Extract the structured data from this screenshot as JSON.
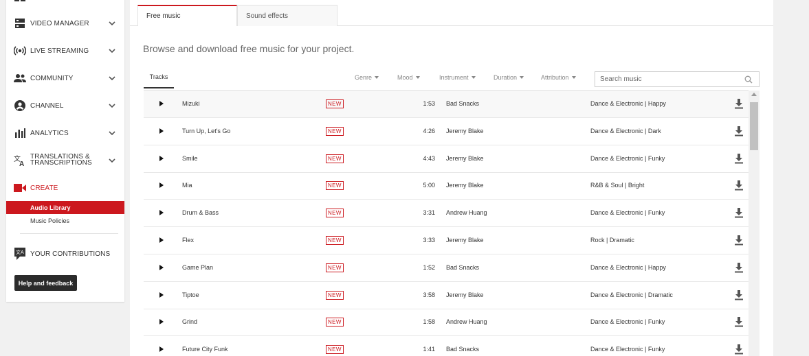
{
  "sidebar": {
    "items": [
      {
        "label": "VIDEO MANAGER",
        "icon": "video-manager-icon"
      },
      {
        "label": "LIVE STREAMING",
        "icon": "live-streaming-icon"
      },
      {
        "label": "COMMUNITY",
        "icon": "community-icon"
      },
      {
        "label": "CHANNEL",
        "icon": "channel-icon"
      },
      {
        "label": "ANALYTICS",
        "icon": "analytics-icon"
      },
      {
        "label": "TRANSLATIONS &",
        "label2": "TRANSCRIPTIONS",
        "icon": "translate-icon"
      },
      {
        "label": "CREATE",
        "icon": "create-icon"
      }
    ],
    "create_sub": [
      "Audio Library",
      "Music Policies"
    ],
    "contributions_label": "YOUR CONTRIBUTIONS",
    "help_label": "Help and feedback"
  },
  "tabs": [
    "Free music",
    "Sound effects"
  ],
  "headline": "Browse and download free music for your project.",
  "tracks_tab": "Tracks",
  "filters": [
    "Genre",
    "Mood",
    "Instrument",
    "Duration",
    "Attribution"
  ],
  "search": {
    "placeholder": "Search music"
  },
  "new_badge": "NEW",
  "tracks": [
    {
      "title": "Mizuki",
      "duration": "1:53",
      "artist": "Bad Snacks",
      "genre": "Dance & Electronic | Happy"
    },
    {
      "title": "Turn Up, Let's Go",
      "duration": "4:26",
      "artist": "Jeremy Blake",
      "genre": "Dance & Electronic | Dark"
    },
    {
      "title": "Smile",
      "duration": "4:43",
      "artist": "Jeremy Blake",
      "genre": "Dance & Electronic | Funky"
    },
    {
      "title": "Mia",
      "duration": "5:00",
      "artist": "Jeremy Blake",
      "genre": "R&B & Soul | Bright"
    },
    {
      "title": "Drum & Bass",
      "duration": "3:31",
      "artist": "Andrew Huang",
      "genre": "Dance & Electronic | Funky"
    },
    {
      "title": "Flex",
      "duration": "3:33",
      "artist": "Jeremy Blake",
      "genre": "Rock | Dramatic"
    },
    {
      "title": "Game Plan",
      "duration": "1:52",
      "artist": "Bad Snacks",
      "genre": "Dance & Electronic | Happy"
    },
    {
      "title": "Tiptoe",
      "duration": "3:58",
      "artist": "Jeremy Blake",
      "genre": "Dance & Electronic | Dramatic"
    },
    {
      "title": "Grind",
      "duration": "1:58",
      "artist": "Andrew Huang",
      "genre": "Dance & Electronic | Funky"
    },
    {
      "title": "Future City Funk",
      "duration": "1:41",
      "artist": "Bad Snacks",
      "genre": "Dance & Electronic | Funky"
    }
  ],
  "colors": {
    "accent": "#cc181e",
    "dark": "#2b2b2b"
  }
}
